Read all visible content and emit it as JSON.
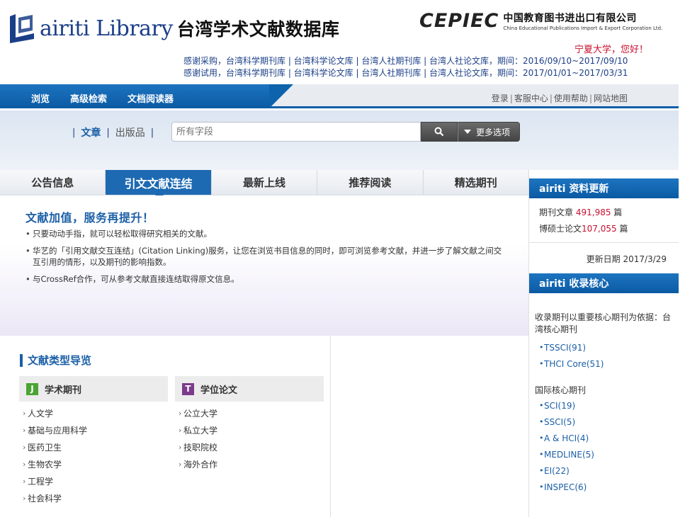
{
  "header": {
    "logo_text": "airiti Library",
    "logo_cn": "台湾学术文献数据库",
    "partner_mark": "CEPIEC",
    "partner_cn": "中国教育图书进出口有限公司",
    "partner_en": "China Educational Publications Import & Export Corporation Ltd.",
    "greeting": "宁夏大学，您好！",
    "notice_1": "感谢采购，台湾科学期刊库 | 台湾科学论文库 | 台湾人社期刊库 | 台湾人社论文库，期间：2016/09/10~2017/09/10",
    "notice_2": "感谢试用，台湾科学期刊库 | 台湾科学论文库 | 台湾人社期刊库 | 台湾人社论文库，期间：2017/01/01~2017/03/31"
  },
  "nav": {
    "links": [
      "浏览",
      "高级检索",
      "文档阅读器"
    ],
    "util": [
      "登录",
      "客服中心",
      "使用帮助",
      "网站地图"
    ]
  },
  "search": {
    "tab_active": "文章",
    "tab_other": "出版品",
    "placeholder": "所有字段",
    "search_icon": "search-icon",
    "more_label": "更多选项"
  },
  "main_tabs": [
    "公告信息",
    "引文文献连结",
    "最新上线",
    "推荐阅读",
    "精选期刊"
  ],
  "panel": {
    "title": "文献加值，服务再提升！",
    "items": [
      "只要动动手指，就可以轻松取得研究相关的文献。",
      "华艺的「引用文献交互连结」(Citation Linking)服务，让您在浏览书目信息的同时，即可浏览参考文献，并进一步了解文献之间交互引用的情形，以及期刊的影响指数。",
      "与CrossRef合作，可从参考文献直接连结取得原文信息。"
    ]
  },
  "guide": {
    "title": "文献类型导览",
    "journal": {
      "badge": "J",
      "label": "学术期刊",
      "items": [
        "人文学",
        "基础与应用科学",
        "医药卫生",
        "生物农学",
        "工程学",
        "社会科学"
      ]
    },
    "thesis": {
      "badge": "T",
      "label": "学位论文",
      "items": [
        "公立大学",
        "私立大学",
        "技职院校",
        "海外合作"
      ]
    }
  },
  "sidebar": {
    "update_title": "airiti 资料更新",
    "journal_label": "期刊文章",
    "journal_count": "491,985",
    "journal_unit": "篇",
    "thesis_label": "博硕士论文",
    "thesis_count": "107,055",
    "thesis_unit": "篇",
    "update_date": "更新日期 2017/3/29",
    "core_title": "airiti 收录核心",
    "core_desc": "收录期刊以重要核心期刊为依据：台湾核心期刊",
    "tw_core": [
      "TSSCI(91)",
      "THCI Core(51)"
    ],
    "intl_title": "国际核心期刊",
    "intl_core": [
      "SCI(19)",
      "SSCI(5)",
      "A & HCI(4)",
      "MEDLINE(5)",
      "EI(22)",
      "INSPEC(6)"
    ]
  },
  "colors": {
    "brand_blue": "#1d6ab2",
    "accent_red": "#c8102e",
    "journal_green": "#4aa433",
    "thesis_purple": "#7b3b8b"
  }
}
